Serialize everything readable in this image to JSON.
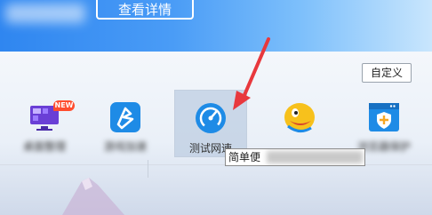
{
  "header": {
    "detail_button": "查看详情"
  },
  "toolbar": {
    "customize_label": "自定义"
  },
  "tools": [
    {
      "label": "桌面整理",
      "badge": "NEW"
    },
    {
      "label": "游戏加速"
    },
    {
      "label": "测试网速"
    },
    {
      "label": ""
    },
    {
      "label": "浏览器保护"
    }
  ],
  "tooltip": {
    "text": "简单便"
  },
  "colors": {
    "header_start": "#2f86f0",
    "arrow": "#e8383d",
    "badge": "#ff4d2e",
    "speed_icon": "#1e8be6"
  }
}
